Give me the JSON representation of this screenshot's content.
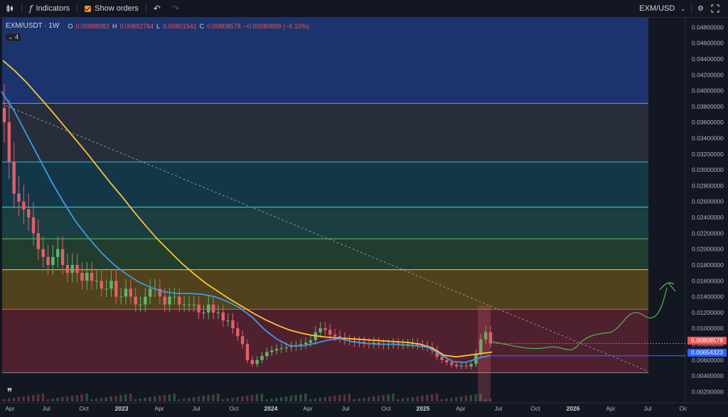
{
  "toolbar": {
    "indicators_label": "Indicators",
    "show_orders_label": "Show orders",
    "symbol": "EXM/USD"
  },
  "legend": {
    "symbol": "EXM/USDT · 1W",
    "open_label": "O",
    "open": "0.00888982",
    "high_label": "H",
    "high": "0.00892784",
    "low_label": "L",
    "low": "0.00801941",
    "close_label": "C",
    "close": "0.00808578",
    "change": "−0.00080899 (−9.10%)"
  },
  "indicator_count": "4",
  "price_tags": {
    "last": "0.00808578",
    "level": "0.00654323"
  },
  "chart_data": {
    "type": "candlestick",
    "symbol": "EXM/USDT",
    "interval": "1W",
    "y_ticks": [
      "0.04800000",
      "0.04600000",
      "0.04400000",
      "0.04200000",
      "0.04000000",
      "0.03800000",
      "0.03600000",
      "0.03400000",
      "0.03200000",
      "0.03000000",
      "0.02800000",
      "0.02600000",
      "0.02400000",
      "0.02200000",
      "0.02000000",
      "0.01800000",
      "0.01600000",
      "0.01400000",
      "0.01200000",
      "0.01000000",
      "0.00800000",
      "0.00600000",
      "0.00400000",
      "0.00200000"
    ],
    "x_ticks": [
      {
        "label": "Apr",
        "bold": false
      },
      {
        "label": "Jul",
        "bold": false
      },
      {
        "label": "Oct",
        "bold": false
      },
      {
        "label": "2023",
        "bold": true
      },
      {
        "label": "Apr",
        "bold": false
      },
      {
        "label": "Jul",
        "bold": false
      },
      {
        "label": "Oct",
        "bold": false
      },
      {
        "label": "2024",
        "bold": true
      },
      {
        "label": "Apr",
        "bold": false
      },
      {
        "label": "Jul",
        "bold": false
      },
      {
        "label": "Oct",
        "bold": false
      },
      {
        "label": "2025",
        "bold": true
      },
      {
        "label": "Apr",
        "bold": false
      },
      {
        "label": "Jul",
        "bold": false
      },
      {
        "label": "Oct",
        "bold": false
      },
      {
        "label": "2026",
        "bold": true
      },
      {
        "label": "Apr",
        "bold": false
      },
      {
        "label": "Jul",
        "bold": false
      },
      {
        "label": "Oc",
        "bold": false
      }
    ],
    "ylim": [
      0.0006,
      0.0492
    ],
    "zones": [
      {
        "from": 0.0384,
        "to": 0.0492,
        "color": "#1e3a7a"
      },
      {
        "from": 0.031,
        "to": 0.0384,
        "color": "#2b3140"
      },
      {
        "from": 0.0253,
        "to": 0.031,
        "color": "#153d4f"
      },
      {
        "from": 0.0213,
        "to": 0.0253,
        "color": "#1d4548"
      },
      {
        "from": 0.0174,
        "to": 0.0213,
        "color": "#244430"
      },
      {
        "from": 0.0124,
        "to": 0.0174,
        "color": "#5a4a1c"
      },
      {
        "from": 0.0044,
        "to": 0.0124,
        "color": "#5a2230"
      }
    ],
    "zone_lines": [
      {
        "value": 0.0384,
        "color": "#8c8f99"
      },
      {
        "value": 0.031,
        "color": "#26c6da"
      },
      {
        "value": 0.0253,
        "color": "#4dd0c4"
      },
      {
        "value": 0.0213,
        "color": "#66bb6a"
      },
      {
        "value": 0.0174,
        "color": "#ffca28"
      },
      {
        "value": 0.0124,
        "color": "#ef5350"
      },
      {
        "value": 0.0044,
        "color": "#8c8f99"
      }
    ],
    "close_series": [
      0.036,
      0.031,
      0.027,
      0.026,
      0.025,
      0.024,
      0.022,
      0.02,
      0.019,
      0.018,
      0.019,
      0.02,
      0.018,
      0.017,
      0.018,
      0.017,
      0.016,
      0.017,
      0.016,
      0.016,
      0.015,
      0.015,
      0.016,
      0.014,
      0.014,
      0.015,
      0.014,
      0.013,
      0.013,
      0.014,
      0.015,
      0.015,
      0.014,
      0.013,
      0.014,
      0.014,
      0.013,
      0.013,
      0.013,
      0.013,
      0.012,
      0.012,
      0.013,
      0.012,
      0.012,
      0.011,
      0.011,
      0.01,
      0.009,
      0.008,
      0.006,
      0.0055,
      0.006,
      0.0065,
      0.007,
      0.0072,
      0.0074,
      0.0075,
      0.0076,
      0.0077,
      0.0078,
      0.008,
      0.0082,
      0.0085,
      0.0095,
      0.01,
      0.0098,
      0.0092,
      0.009,
      0.0088,
      0.0085,
      0.0084,
      0.0082,
      0.0083,
      0.0081,
      0.008,
      0.0082,
      0.008,
      0.0079,
      0.008,
      0.0081,
      0.0079,
      0.008,
      0.008,
      0.0081,
      0.0079,
      0.0078,
      0.0076,
      0.0072,
      0.0064,
      0.006,
      0.0057,
      0.0054,
      0.0052,
      0.0053,
      0.0052,
      0.0055,
      0.0068,
      0.0086,
      0.0095,
      0.0081
    ],
    "ema_yellow": [
      0.0438,
      0.0425,
      0.041,
      0.0393,
      0.0376,
      0.0358,
      0.034,
      0.0322,
      0.0303,
      0.0284,
      0.0266,
      0.0247,
      0.0229,
      0.0212,
      0.0197,
      0.0182,
      0.0169,
      0.0157,
      0.0147,
      0.0137,
      0.0128,
      0.0119,
      0.0111,
      0.0104,
      0.0098,
      0.0094,
      0.0091,
      0.0089,
      0.0088,
      0.0087,
      0.0086,
      0.0085,
      0.0084,
      0.0083,
      0.0082,
      0.008,
      0.0075,
      0.0066,
      0.0064,
      0.0066,
      0.0068,
      0.007
    ],
    "ema_blue": [
      0.0399,
      0.0375,
      0.0345,
      0.0315,
      0.0285,
      0.0258,
      0.0233,
      0.0213,
      0.0195,
      0.018,
      0.0168,
      0.0158,
      0.0151,
      0.0146,
      0.0144,
      0.0144,
      0.0143,
      0.014,
      0.0134,
      0.0126,
      0.0114,
      0.0098,
      0.0086,
      0.0078,
      0.0078,
      0.0081,
      0.0085,
      0.0087,
      0.0083,
      0.0081,
      0.008,
      0.008,
      0.0079,
      0.0078,
      0.0076,
      0.0067,
      0.0058,
      0.0057,
      0.0062,
      0.0066
    ],
    "trendline": {
      "from": 0.0384,
      "to": 0.0044
    },
    "horizontal_levels": [
      {
        "value": 0.00808578,
        "color": "#ef5350",
        "style": "dotted"
      },
      {
        "value": 0.00654323,
        "color": "#2962ff",
        "style": "solid"
      }
    ],
    "projection_curve": "green hand-drawn path rising from ~0.0080 to ~0.0145 with arrow"
  }
}
